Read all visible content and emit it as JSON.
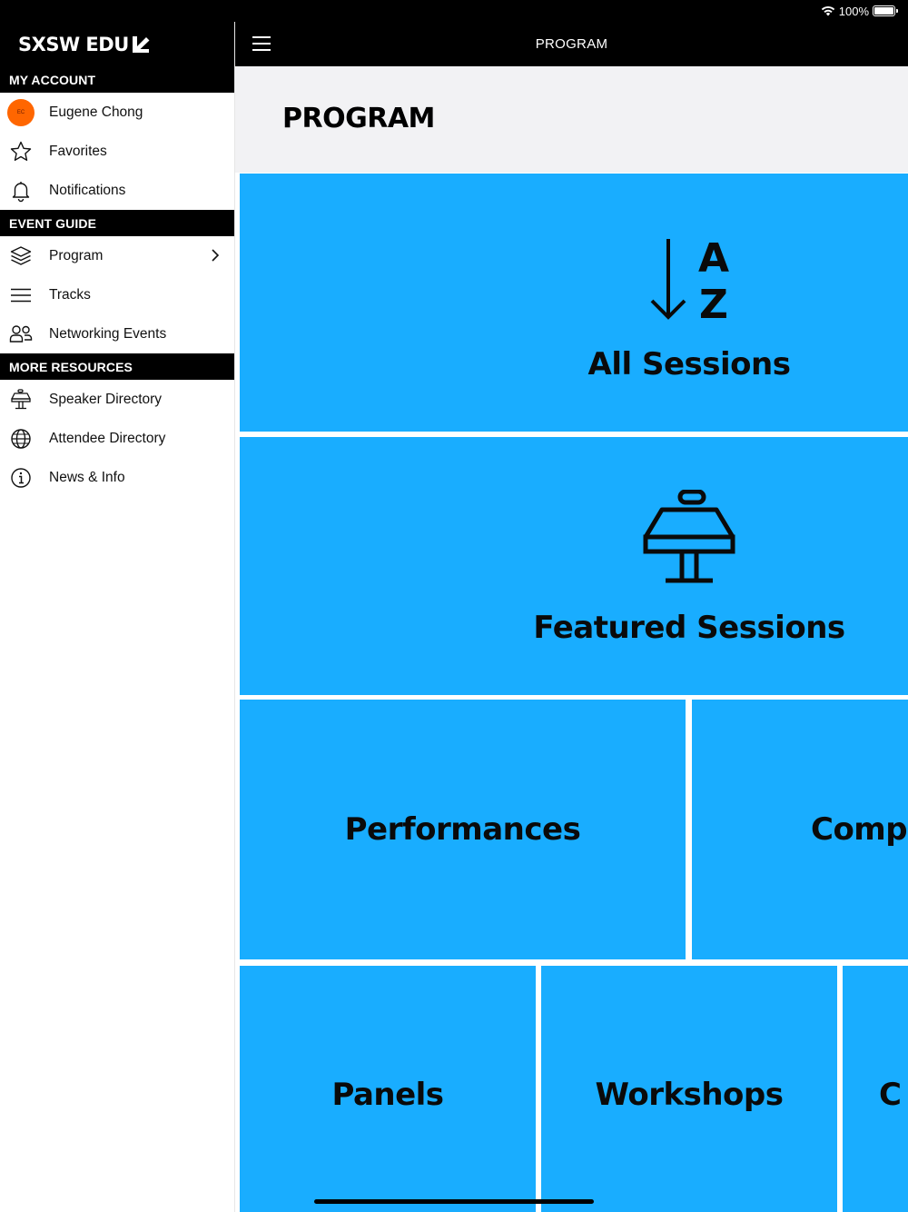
{
  "status_bar": {
    "battery_text": "100%",
    "battery_level": 1.0
  },
  "app": {
    "logo_text": "SXSW EDU"
  },
  "topbar": {
    "title": "PROGRAM"
  },
  "page": {
    "title": "PROGRAM"
  },
  "sidebar": {
    "sections": [
      {
        "header": "MY ACCOUNT",
        "items": [
          {
            "label": "Eugene Chong",
            "icon": "avatar",
            "avatar_initials": "EC"
          },
          {
            "label": "Favorites",
            "icon": "star-icon"
          },
          {
            "label": "Notifications",
            "icon": "bell-icon"
          }
        ]
      },
      {
        "header": "EVENT GUIDE",
        "items": [
          {
            "label": "Program",
            "icon": "layers-icon",
            "chevron": true
          },
          {
            "label": "Tracks",
            "icon": "lines-icon"
          },
          {
            "label": "Networking Events",
            "icon": "people-icon"
          }
        ]
      },
      {
        "header": "MORE RESOURCES",
        "items": [
          {
            "label": "Speaker Directory",
            "icon": "podium-icon"
          },
          {
            "label": "Attendee Directory",
            "icon": "globe-icon"
          },
          {
            "label": "News & Info",
            "icon": "info-icon"
          }
        ]
      }
    ]
  },
  "tiles": [
    {
      "label": "All Sessions",
      "icon": "sort-az-icon"
    },
    {
      "label": "Featured Sessions",
      "icon": "podium-icon"
    },
    {
      "label": "Performances"
    },
    {
      "label": "Comp"
    },
    {
      "label": "Panels"
    },
    {
      "label": "Workshops"
    },
    {
      "label": "C"
    }
  ],
  "colors": {
    "tile_blue": "#19adff",
    "avatar_orange": "#ff6600",
    "header_black": "#000000"
  }
}
